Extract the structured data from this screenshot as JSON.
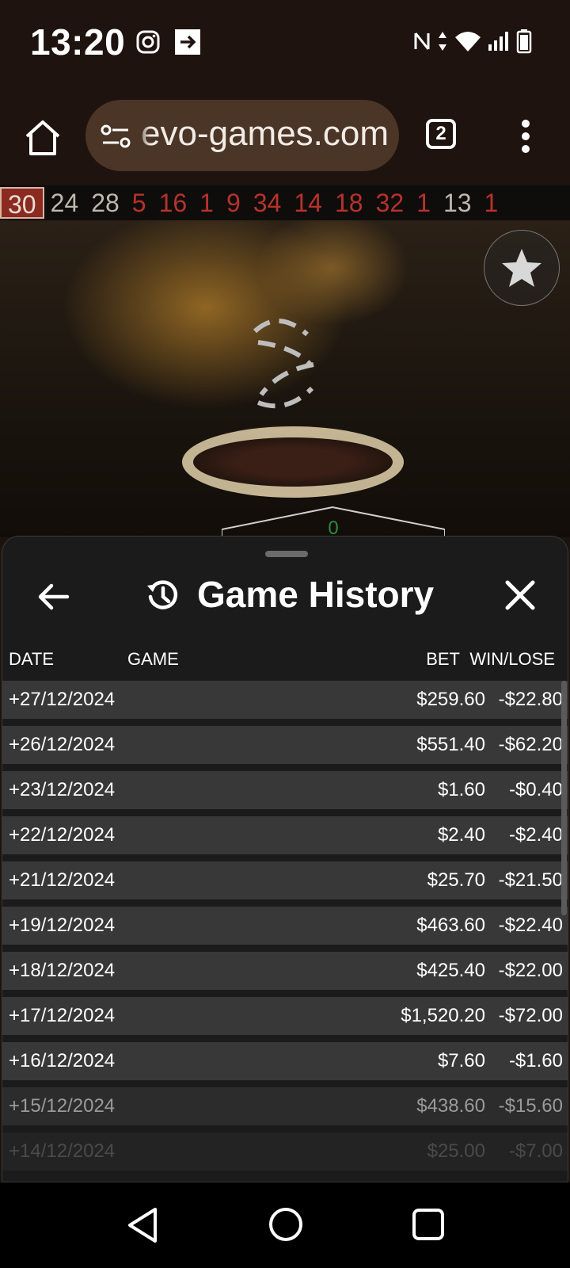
{
  "status_bar": {
    "time": "13:20"
  },
  "browser": {
    "url_text": "evo-games.com",
    "tab_count": "2"
  },
  "results": [
    {
      "n": "30",
      "color": "red",
      "latest": true
    },
    {
      "n": "24",
      "color": "black"
    },
    {
      "n": "28",
      "color": "black"
    },
    {
      "n": "5",
      "color": "red"
    },
    {
      "n": "16",
      "color": "red"
    },
    {
      "n": "1",
      "color": "red"
    },
    {
      "n": "9",
      "color": "red"
    },
    {
      "n": "34",
      "color": "red"
    },
    {
      "n": "14",
      "color": "red"
    },
    {
      "n": "18",
      "color": "red"
    },
    {
      "n": "32",
      "color": "red"
    },
    {
      "n": "1",
      "color": "red"
    },
    {
      "n": "13",
      "color": "black"
    },
    {
      "n": "1",
      "color": "red"
    }
  ],
  "video": {
    "zero_label": "0"
  },
  "sheet": {
    "title": "Game History",
    "columns": {
      "date": "DATE",
      "game": "GAME",
      "bet": "BET",
      "win_lose": "WIN/LOSE"
    },
    "rows": [
      {
        "date": "+27/12/2024",
        "bet": "$259.60",
        "win_lose": "-$22.80"
      },
      {
        "date": "+26/12/2024",
        "bet": "$551.40",
        "win_lose": "-$62.20"
      },
      {
        "date": "+23/12/2024",
        "bet": "$1.60",
        "win_lose": "-$0.40"
      },
      {
        "date": "+22/12/2024",
        "bet": "$2.40",
        "win_lose": "-$2.40"
      },
      {
        "date": "+21/12/2024",
        "bet": "$25.70",
        "win_lose": "-$21.50"
      },
      {
        "date": "+19/12/2024",
        "bet": "$463.60",
        "win_lose": "-$22.40"
      },
      {
        "date": "+18/12/2024",
        "bet": "$425.40",
        "win_lose": "-$22.00"
      },
      {
        "date": "+17/12/2024",
        "bet": "$1,520.20",
        "win_lose": "-$72.00"
      },
      {
        "date": "+16/12/2024",
        "bet": "$7.60",
        "win_lose": "-$1.60"
      },
      {
        "date": "+15/12/2024",
        "bet": "$438.60",
        "win_lose": "-$15.60"
      },
      {
        "date": "+14/12/2024",
        "bet": "$25.00",
        "win_lose": "-$7.00"
      }
    ]
  }
}
